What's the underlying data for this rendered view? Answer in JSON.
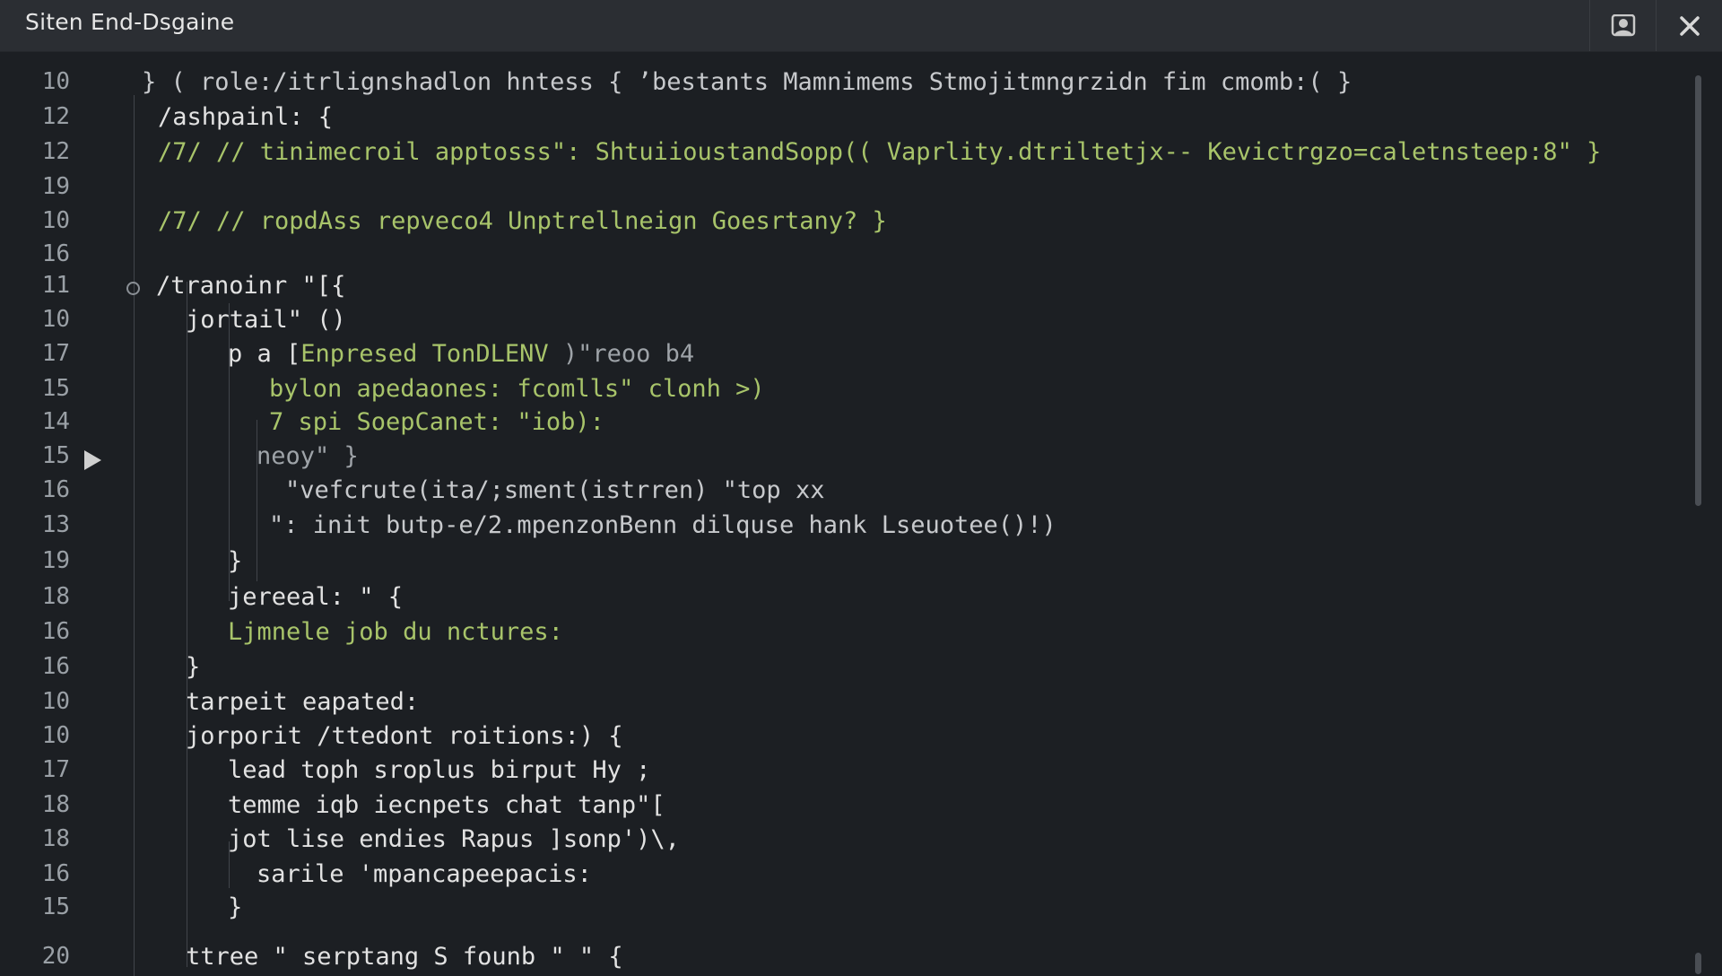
{
  "window": {
    "title": "Siten End-Dsgaine",
    "buttons": {
      "user_icon": "user-icon",
      "close_icon": "close-icon",
      "close_label": "✕"
    }
  },
  "editor": {
    "lines": [
      {
        "num": "10",
        "text": "} ( role:/itrlignshadlon hntess { ’bestants Mamnimems Stmojitmngrzidn fim cmomb:( }",
        "color": "soft"
      },
      {
        "num": "12",
        "text": "/ashpainl: {",
        "color": "white"
      },
      {
        "num": "12",
        "text": "/7/ // tinimecroil apptosss\": ShtuiioustandSopp(( Vaprlity.dtriltetjx-- Kevictrgzo=caletnsteep:8\" }",
        "color": "green"
      },
      {
        "num": "19",
        "text": "",
        "color": "white"
      },
      {
        "num": "10",
        "text": "/7/ // ropdAss repveco4 Unptrellneign Goesrtany? }",
        "color": "green"
      },
      {
        "num": "16",
        "text": "",
        "color": "white"
      },
      {
        "num": "11",
        "text": "/tranoinr \"[{",
        "color": "white"
      },
      {
        "num": "10",
        "text": "jortail\" ()",
        "color": "white"
      },
      {
        "num": "17",
        "text": "p a [Enpresed TonDLENV )\"reoo b4",
        "color": "mixed1"
      },
      {
        "num": "15",
        "text": "bylon apedaones: fcomlls\" clonh >)",
        "color": "green"
      },
      {
        "num": "14",
        "text": "7 spi SoepCanet: \"iob):",
        "color": "green"
      },
      {
        "num": "15",
        "text": "neoy\" }",
        "color": "dim"
      },
      {
        "num": "16",
        "text": "\"vefcrute(ita/;sment(istrren) \"top xx",
        "color": "soft"
      },
      {
        "num": "13",
        "text": "\": init butp-e/2.mpenzonBenn dilquse hank Lseuotee()!)",
        "color": "soft"
      },
      {
        "num": "19",
        "text": "}",
        "color": "white"
      },
      {
        "num": "18",
        "text": "jereeal: \" {",
        "color": "white"
      },
      {
        "num": "16",
        "text": "Ljmnele job du nctures:",
        "color": "green"
      },
      {
        "num": "16",
        "text": "}",
        "color": "white"
      },
      {
        "num": "10",
        "text": "tarpeit eapated:",
        "color": "white"
      },
      {
        "num": "10",
        "text": "jorporit /ttedont roitions:) {",
        "color": "white"
      },
      {
        "num": "17",
        "text": "lead toph sroplus birput Hy ;",
        "color": "white"
      },
      {
        "num": "18",
        "text": "temme iqb iecnpets chat tanp\"[",
        "color": "white"
      },
      {
        "num": "18",
        "text": "jot lise endies Rapus ]sonp')\\,",
        "color": "white"
      },
      {
        "num": "16",
        "text": "sarile 'mpancapeepacis:",
        "color": "white"
      },
      {
        "num": "15",
        "text": "}",
        "color": "white"
      },
      {
        "num": "20",
        "text": "ttree \" serptang S founb \" \" {",
        "color": "white"
      }
    ]
  },
  "colors": {
    "background": "#1c1f23",
    "titlebar": "#2b2e33",
    "text": "#e2e2e2",
    "green": "#a8c46a",
    "line_number": "#9aa0a6"
  }
}
